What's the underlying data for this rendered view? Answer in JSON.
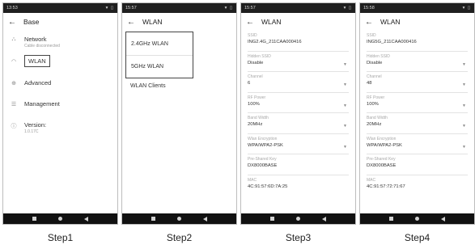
{
  "step1": {
    "time": "13:53",
    "status_icons": "▾ ▯",
    "title": "Base",
    "items": [
      {
        "label": "Network",
        "sub": "Cable disconnected",
        "icon": "network-icon"
      },
      {
        "label": "WLAN",
        "sub": "",
        "icon": "wifi-icon"
      },
      {
        "label": "Advanced",
        "sub": "",
        "icon": "plus-circle-icon"
      },
      {
        "label": "Management",
        "sub": "",
        "icon": "menu-lines-icon"
      },
      {
        "label": "Version:",
        "sub": "1.0.17C",
        "icon": "info-icon"
      }
    ],
    "caption": "Step1"
  },
  "step2": {
    "time": "15:57",
    "status_icons": "▾ ▯",
    "title": "WLAN",
    "items": [
      "2.4GHz WLAN",
      "5GHz WLAN",
      "WLAN Clients"
    ],
    "caption": "Step2"
  },
  "step3": {
    "time": "15:57",
    "status_icons": "▾ ▯",
    "title": "WLAN",
    "fields": [
      {
        "label": "SSID",
        "value": "ING2.4G_211CAA000416",
        "dropdown": false
      },
      {
        "label": "Hidden SSID",
        "value": "Disable",
        "dropdown": true
      },
      {
        "label": "Channel",
        "value": "6",
        "dropdown": true
      },
      {
        "label": "RF Power",
        "value": "100%",
        "dropdown": true
      },
      {
        "label": "Band Width",
        "value": "20MHz",
        "dropdown": true
      },
      {
        "label": "Wlan Encryption",
        "value": "WPA/WPA2-PSK",
        "dropdown": true
      },
      {
        "label": "Pre-Shared Key",
        "value": "DX8000BASE",
        "dropdown": false
      },
      {
        "label": "MAC",
        "value": "4C:91:57:6D:7A:25",
        "dropdown": false
      }
    ],
    "caption": "Step3"
  },
  "step4": {
    "time": "15:58",
    "status_icons": "▾ ▯",
    "title": "WLAN",
    "fields": [
      {
        "label": "SSID",
        "value": "ING5G_211CAA000416",
        "dropdown": false
      },
      {
        "label": "Hidden SSID",
        "value": "Disable",
        "dropdown": true
      },
      {
        "label": "Channel",
        "value": "48",
        "dropdown": true
      },
      {
        "label": "RF Power",
        "value": "100%",
        "dropdown": true
      },
      {
        "label": "Band Width",
        "value": "20MHz",
        "dropdown": true
      },
      {
        "label": "Wlan Encryption",
        "value": "WPA/WPA2-PSK",
        "dropdown": true
      },
      {
        "label": "Pre-Shared Key",
        "value": "DX8000BASE",
        "dropdown": false
      },
      {
        "label": "MAC",
        "value": "4C:91:57:72:71:67",
        "dropdown": false
      }
    ],
    "caption": "Step4"
  }
}
